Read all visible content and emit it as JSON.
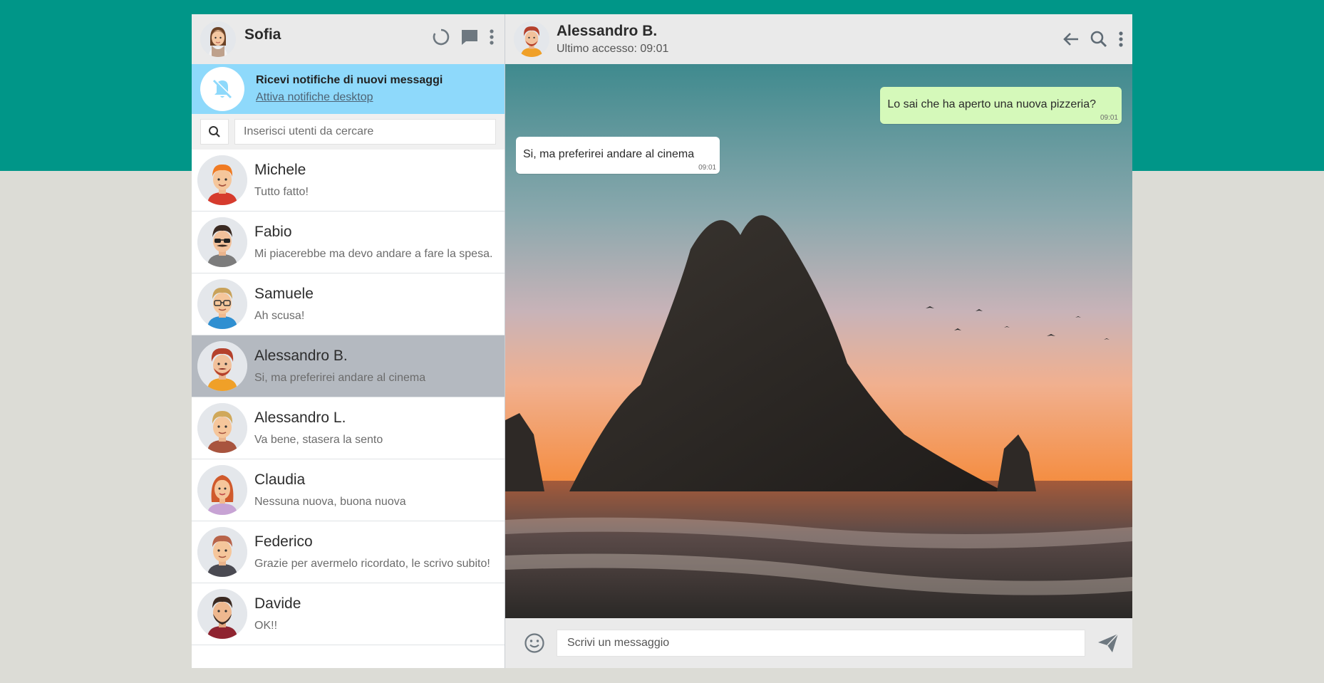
{
  "user": {
    "name": "Sofia",
    "avatar": "avatar-sofia"
  },
  "sidebar_icons": [
    "status-icon",
    "chat-icon",
    "menu-dots-icon"
  ],
  "notification": {
    "title": "Ricevi notifiche di nuovi messaggi",
    "link": "Attiva notifiche desktop",
    "icon": "bell-off-icon"
  },
  "search": {
    "placeholder": "Inserisci utenti da cercare",
    "icon": "search-icon"
  },
  "contacts": [
    {
      "name": "Michele",
      "last_message": "Tutto fatto!",
      "active": false
    },
    {
      "name": "Fabio",
      "last_message": "Mi piacerebbe ma devo andare a fare la spesa.",
      "active": false
    },
    {
      "name": "Samuele",
      "last_message": "Ah scusa!",
      "active": false
    },
    {
      "name": "Alessandro B.",
      "last_message": "Si, ma preferirei andare al cinema",
      "active": true
    },
    {
      "name": "Alessandro L.",
      "last_message": "Va bene, stasera la sento",
      "active": false
    },
    {
      "name": "Claudia",
      "last_message": "Nessuna nuova, buona nuova",
      "active": false
    },
    {
      "name": "Federico",
      "last_message": "Grazie per avermelo ricordato, le scrivo subito!",
      "active": false
    },
    {
      "name": "Davide",
      "last_message": "OK!!",
      "active": false
    }
  ],
  "chat": {
    "name": "Alessandro B.",
    "status": "Ultimo accesso: 09:01",
    "header_icons": [
      "back-arrow-icon",
      "search-icon",
      "menu-dots-icon"
    ],
    "messages": [
      {
        "type": "sent",
        "text": "Lo sai che ha aperto una nuova pizzeria?",
        "time": "09:01"
      },
      {
        "type": "received",
        "text": "Si, ma preferirei andare al cinema",
        "time": "09:01"
      }
    ]
  },
  "composer": {
    "placeholder": "Scrivi un messaggio",
    "emoji_icon": "emoji-icon",
    "send_icon": "send-icon"
  },
  "colors": {
    "accent": "#009688",
    "background": "#dcdcd6",
    "notification": "#8ed9fb",
    "active_contact": "#b4b9c0",
    "sent_bubble": "#d5f9ba"
  }
}
